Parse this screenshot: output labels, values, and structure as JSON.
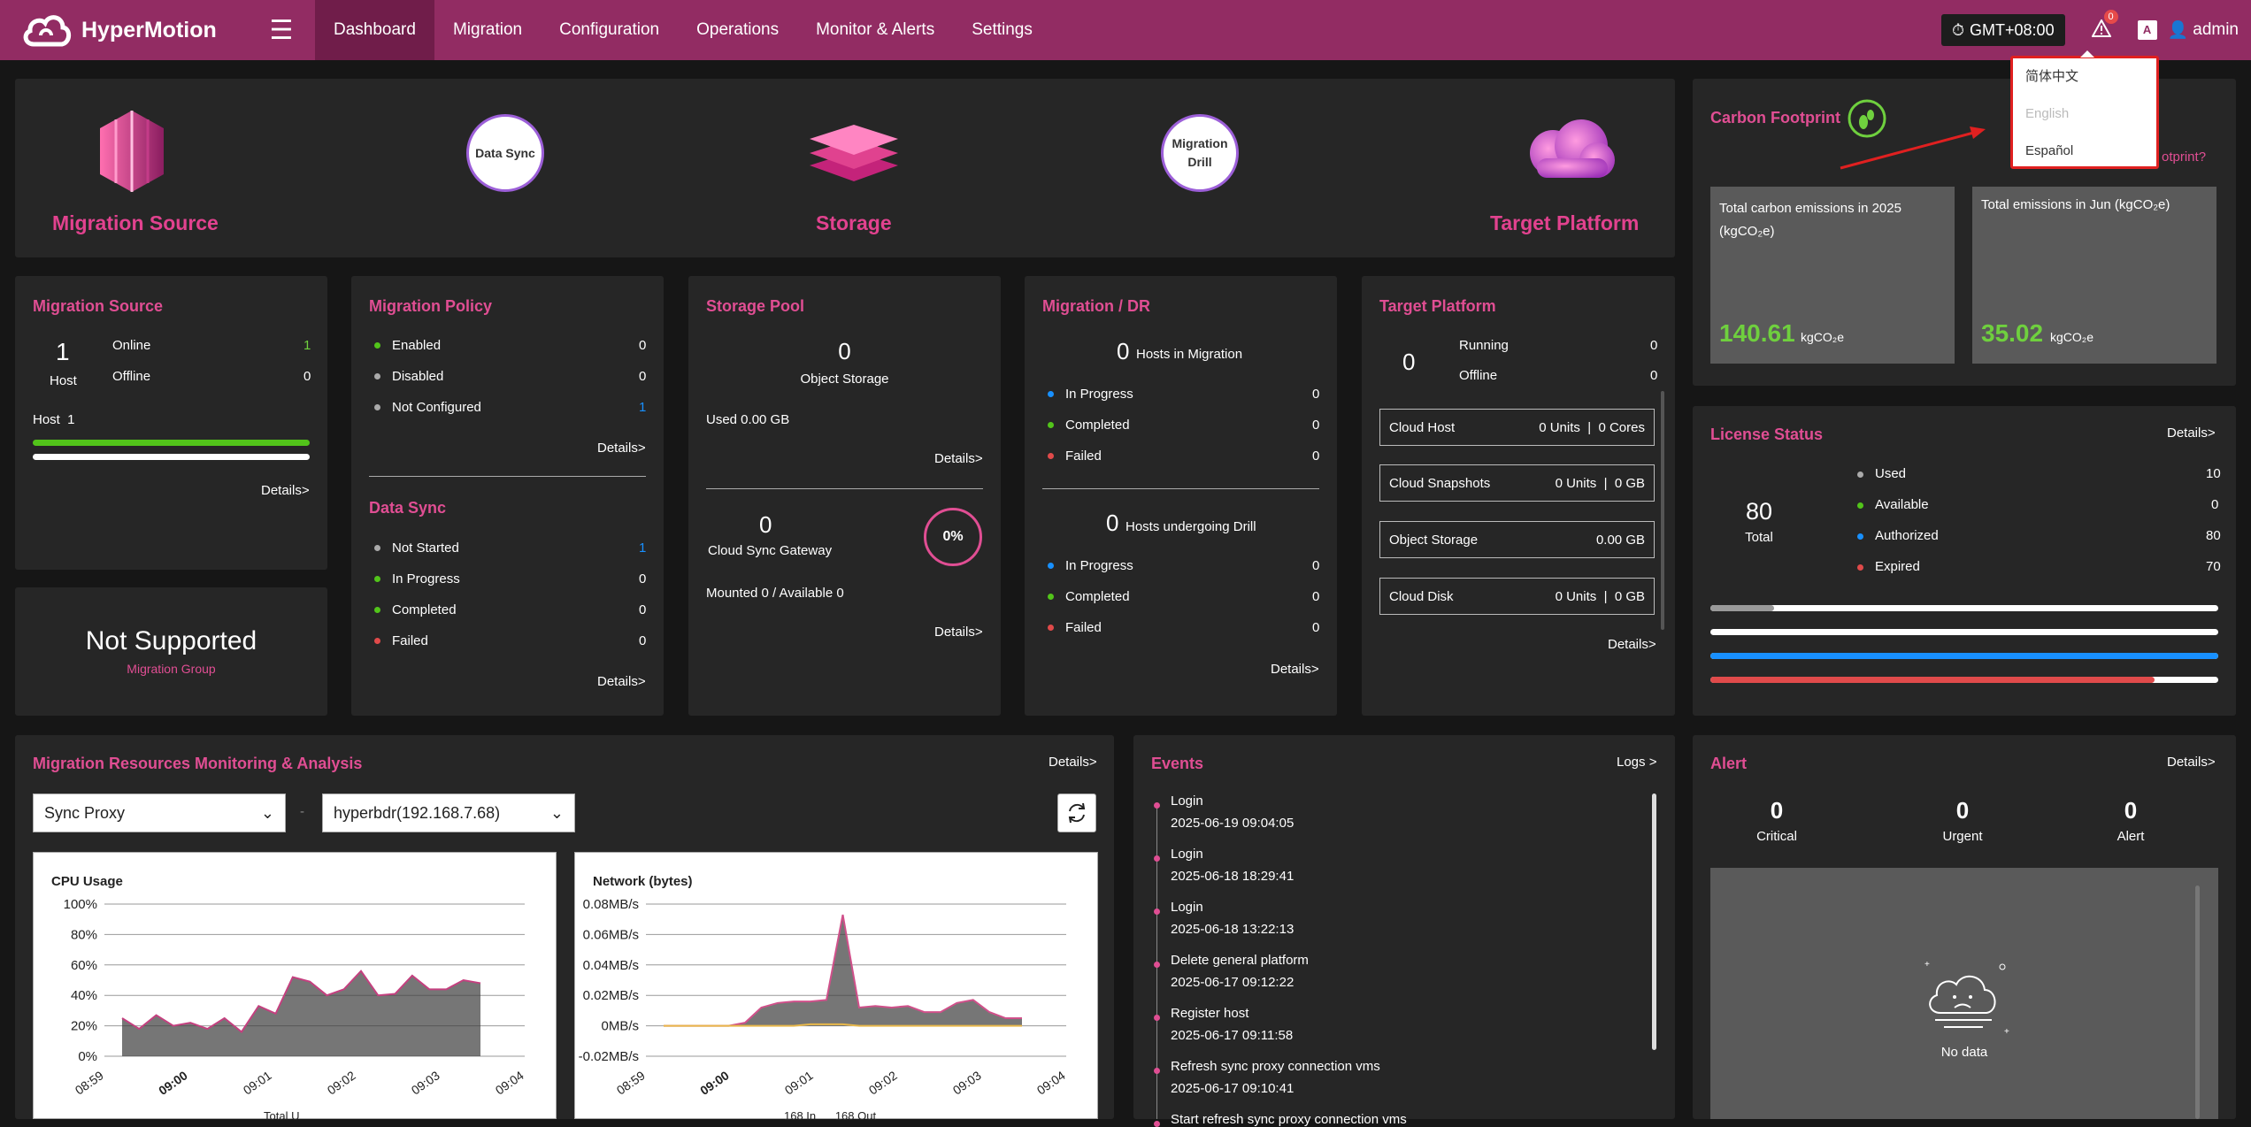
{
  "header": {
    "brand": "HyperMotion",
    "nav": [
      "Dashboard",
      "Migration",
      "Configuration",
      "Operations",
      "Monitor & Alerts",
      "Settings"
    ],
    "timezone": "GMT+08:00",
    "alert_badge": "0",
    "user": "admin",
    "lang_icon": "A"
  },
  "lang_menu": [
    "简体中文",
    "English",
    "Español"
  ],
  "flow": {
    "source": "Migration Source",
    "storage": "Storage",
    "target": "Target Platform",
    "sync": "Data Sync",
    "drill1": "Migration",
    "drill2": "Drill"
  },
  "carbon": {
    "title": "Carbon Footprint",
    "link": "otprint?",
    "box1_label": "Total carbon emissions in 2025 (kgCO₂e)",
    "box1_value": "140.61",
    "box1_unit": "kgCO₂e",
    "box2_label": "Total emissions in Jun (kgCO₂e)",
    "box2_value": "35.02",
    "box2_unit": "kgCO₂e"
  },
  "msource": {
    "title": "Migration Source",
    "count": "1",
    "count_label": "Host",
    "online_label": "Online",
    "online": "1",
    "offline_label": "Offline",
    "offline": "0",
    "host_label": "Host  1",
    "details": "Details>"
  },
  "notsupported": {
    "title": "Not Supported",
    "sub": "Migration Group"
  },
  "policy": {
    "title": "Migration Policy",
    "enabled_l": "Enabled",
    "enabled": "0",
    "disabled_l": "Disabled",
    "disabled": "0",
    "nc_l": "Not Configured",
    "nc": "1",
    "details": "Details>"
  },
  "datasync": {
    "title": "Data Sync",
    "ns_l": "Not Started",
    "ns": "1",
    "ip_l": "In Progress",
    "ip": "0",
    "c_l": "Completed",
    "c": "0",
    "f_l": "Failed",
    "f": "0",
    "details": "Details>"
  },
  "pool": {
    "title": "Storage Pool",
    "obj": "0",
    "obj_l": "Object Storage",
    "used": "Used 0.00 GB",
    "details": "Details>",
    "gw": "0",
    "gw_l": "Cloud Sync Gateway",
    "pct": "0%",
    "mounted": "Mounted 0 / Available 0",
    "details2": "Details>"
  },
  "mdr": {
    "title": "Migration / DR",
    "him": "0",
    "him_l": "Hosts in Migration",
    "ip_l": "In Progress",
    "ip": "0",
    "c_l": "Completed",
    "c": "0",
    "f_l": "Failed",
    "f": "0",
    "hud": "0",
    "hud_l": "Hosts undergoing Drill",
    "ip2": "0",
    "c2": "0",
    "f2": "0",
    "details": "Details>"
  },
  "target": {
    "title": "Target Platform",
    "count": "0",
    "run_l": "Running",
    "run": "0",
    "off_l": "Offline",
    "off": "0",
    "rows": [
      {
        "l": "Cloud Host",
        "v": "0 Units  |  0 Cores"
      },
      {
        "l": "Cloud Snapshots",
        "v": "0 Units  |  0 GB"
      },
      {
        "l": "Object Storage",
        "v": "0.00 GB"
      },
      {
        "l": "Cloud Disk",
        "v": "0 Units  |  0 GB"
      }
    ],
    "details": "Details>"
  },
  "license": {
    "title": "License Status",
    "details": "Details>",
    "total": "80",
    "total_l": "Total",
    "used_l": "Used",
    "used": "10",
    "avail_l": "Available",
    "avail": "0",
    "auth_l": "Authorized",
    "auth": "80",
    "exp_l": "Expired",
    "exp": "70",
    "used_frac": 0.125,
    "avail_frac": 0,
    "auth_frac": 1,
    "exp_frac": 0.875
  },
  "mon": {
    "title": "Migration Resources Monitoring & Analysis",
    "details": "Details>",
    "sel1": "Sync Proxy",
    "sep": "-",
    "sel2": "hyperbdr(192.168.7.68)",
    "cpu_title": "CPU Usage",
    "net_title": "Network (bytes)",
    "cpu_bottom": "Total U",
    "net_bottom": "168 In      168 Out"
  },
  "events": {
    "title": "Events",
    "logs": "Logs >",
    "items": [
      {
        "t": "Login",
        "d": "2025-06-19 09:04:05"
      },
      {
        "t": "Login",
        "d": "2025-06-18 18:29:41"
      },
      {
        "t": "Login",
        "d": "2025-06-18 13:22:13"
      },
      {
        "t": "Delete general platform",
        "d": "2025-06-17 09:12:22"
      },
      {
        "t": "Register host",
        "d": "2025-06-17 09:11:58"
      },
      {
        "t": "Refresh sync proxy connection vms",
        "d": "2025-06-17 09:10:41"
      },
      {
        "t": "Start refresh sync proxy connection vms",
        "d": ""
      }
    ]
  },
  "alert": {
    "title": "Alert",
    "details": "Details>",
    "crit": "0",
    "crit_l": "Critical",
    "urg": "0",
    "urg_l": "Urgent",
    "al": "0",
    "al_l": "Alert",
    "nodata": "No data"
  },
  "chart_data": [
    {
      "type": "area",
      "title": "CPU Usage",
      "x": [
        "08:59",
        "09:00",
        "09:01",
        "09:02",
        "09:03",
        "09:04"
      ],
      "ylim": [
        0,
        100
      ],
      "yticks": [
        "0%",
        "20%",
        "40%",
        "60%",
        "80%",
        "100%"
      ],
      "series": [
        {
          "values": [
            25,
            18,
            27,
            20,
            22,
            18,
            25,
            16,
            33,
            28,
            52,
            49,
            40,
            44,
            56,
            40,
            41,
            53,
            44,
            44,
            50,
            48
          ]
        }
      ],
      "bottom_label": "Total U"
    },
    {
      "type": "area",
      "title": "Network (bytes)",
      "x": [
        "08:59",
        "09:00",
        "09:01",
        "09:02",
        "09:03",
        "09:04"
      ],
      "ylim": [
        -0.02,
        0.08
      ],
      "yticks": [
        "-0.02MB/s",
        "0MB/s",
        "0.02MB/s",
        "0.04MB/s",
        "0.06MB/s",
        "0.08MB/s"
      ],
      "series": [
        {
          "values": [
            0,
            0,
            0,
            0,
            0,
            0.002,
            0.012,
            0.015,
            0.016,
            0.016,
            0.017,
            0.073,
            0.012,
            0.013,
            0.012,
            0.013,
            0.009,
            0.009,
            0.015,
            0.017,
            0.009,
            0.005,
            0.005
          ]
        },
        {
          "values": [
            0,
            0,
            0,
            0,
            0,
            0,
            0,
            0,
            0,
            0.001,
            0.001,
            0.001,
            0,
            0,
            0,
            0,
            0,
            0,
            0,
            0,
            0,
            0,
            0
          ]
        }
      ]
    }
  ]
}
